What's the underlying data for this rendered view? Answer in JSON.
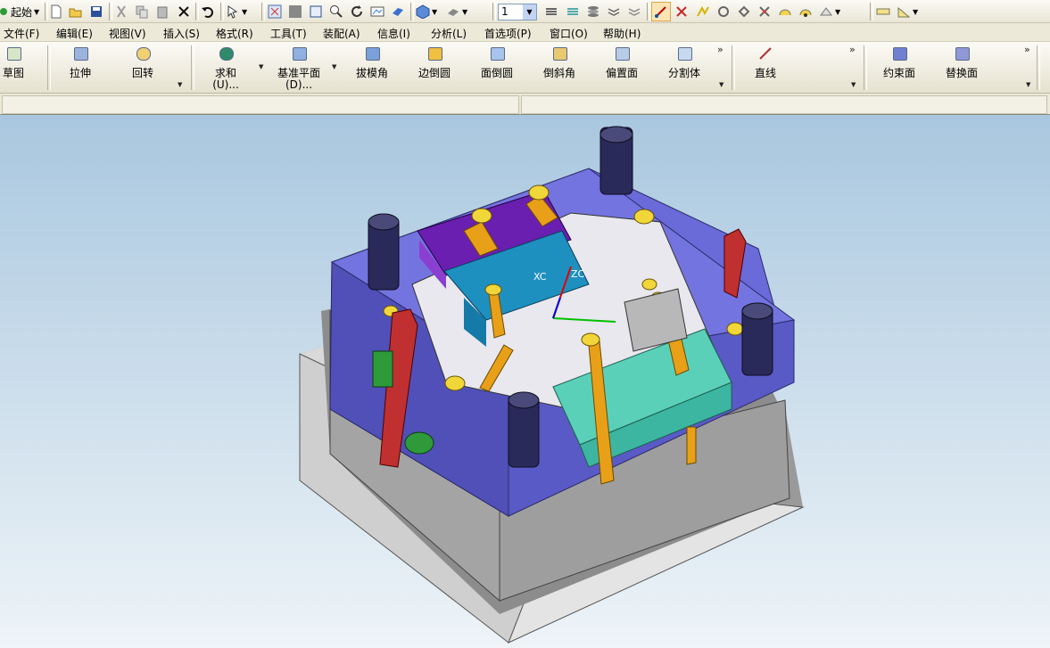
{
  "toolbar": {
    "start_label": "起始",
    "layer_value": "1",
    "icons": [
      "new-file-icon",
      "open-folder-icon",
      "save-icon",
      "cut-icon",
      "copy-icon",
      "paste-icon",
      "delete-icon",
      "undo-icon",
      "select-filter-icon",
      "fit-view-icon",
      "zoom-box-icon",
      "frame-icon",
      "zoom-icon",
      "rotate-icon",
      "pan-icon",
      "render-icon",
      "cube-view-icon",
      "shading-icon",
      "layer-settings-icon",
      "layer-visible-icon",
      "layer-move-icon",
      "layer-copy-icon",
      "layer-delete-icon",
      "snap-point-icon",
      "snap-end-icon",
      "snap-mid-icon",
      "snap-center-icon",
      "snap-quadrant-icon",
      "snap-intersect-icon",
      "snap-arc-icon",
      "measure-distance-icon",
      "measure-angle-icon"
    ]
  },
  "menu": [
    "文件(F)",
    "编辑(E)",
    "视图(V)",
    "插入(S)",
    "格式(R)",
    "工具(T)",
    "装配(A)",
    "信息(I)",
    "分析(L)",
    "首选项(P)",
    "窗口(O)",
    "帮助(H)"
  ],
  "feature_toolbar": {
    "items": [
      {
        "label": "草图",
        "icon": "sketch-icon"
      },
      {
        "label": "拉伸",
        "icon": "extrude-icon"
      },
      {
        "label": "回转",
        "icon": "revolve-icon"
      },
      {
        "label": "求和",
        "sub": "(U)...",
        "icon": "unite-icon"
      },
      {
        "label": "基准平面",
        "sub": "(D)...",
        "icon": "datum-plane-icon"
      },
      {
        "label": "拔模角",
        "icon": "draft-icon"
      },
      {
        "label": "边倒圆",
        "icon": "edge-blend-icon"
      },
      {
        "label": "面倒圆",
        "icon": "face-blend-icon"
      },
      {
        "label": "倒斜角",
        "icon": "chamfer-icon"
      },
      {
        "label": "偏置面",
        "icon": "offset-face-icon"
      },
      {
        "label": "分割体",
        "icon": "split-body-icon"
      },
      {
        "label": "直线",
        "icon": "line-icon"
      },
      {
        "label": "约束面",
        "icon": "constrain-face-icon"
      },
      {
        "label": "替换面",
        "icon": "replace-face-icon"
      }
    ]
  },
  "viewport": {
    "axis_label": "XC",
    "axis_label2": "ZC",
    "background_top": "#a9c7df",
    "background_bottom": "#eef4f8"
  }
}
